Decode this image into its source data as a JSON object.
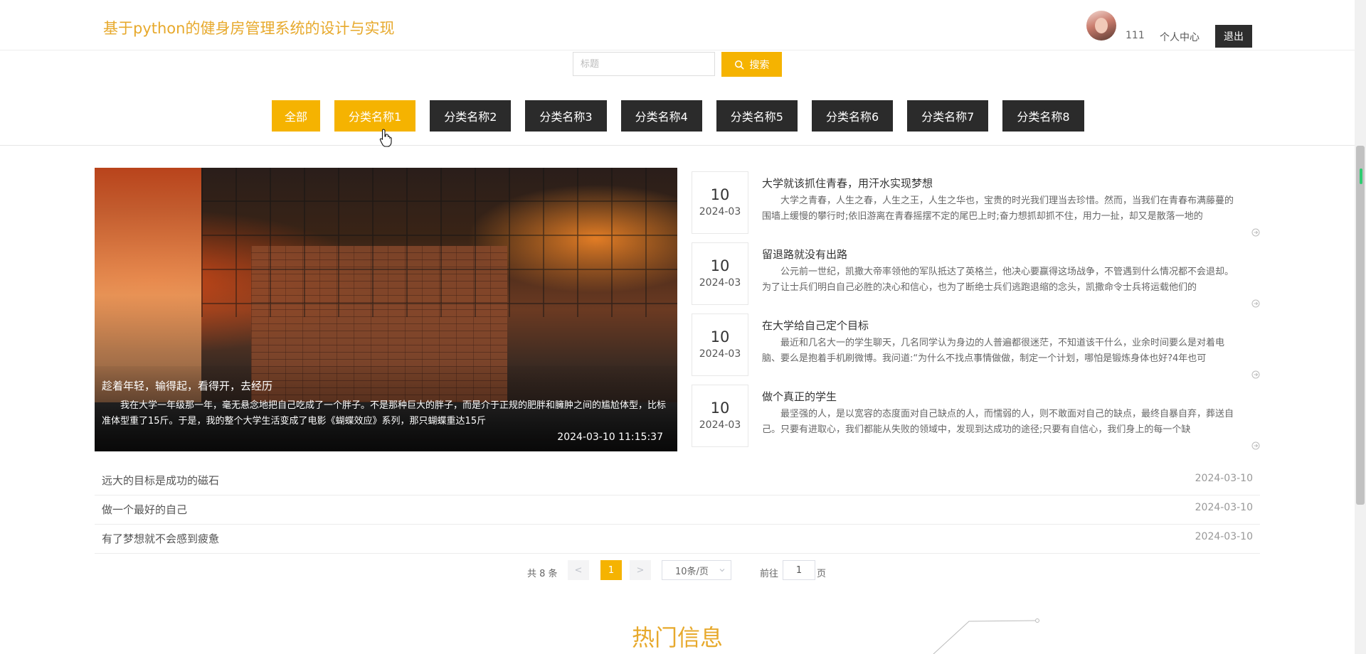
{
  "header": {
    "site_title": "基于python的健身房管理系统的设计与实现",
    "username": "111",
    "personal_center": "个人中心",
    "logout": "退出"
  },
  "search": {
    "placeholder": "标题",
    "button_label": "搜索"
  },
  "categories": [
    {
      "label": "全部"
    },
    {
      "label": "分类名称1"
    },
    {
      "label": "分类名称2"
    },
    {
      "label": "分类名称3"
    },
    {
      "label": "分类名称4"
    },
    {
      "label": "分类名称5"
    },
    {
      "label": "分类名称6"
    },
    {
      "label": "分类名称7"
    },
    {
      "label": "分类名称8"
    }
  ],
  "active_category_index": 1,
  "featured": {
    "title": "趁着年轻，输得起，看得开，去经历",
    "description": "我在大学一年级那一年，毫无悬念地把自己吃成了一个胖子。不是那种巨大的胖子，而是介于正规的肥胖和臃肿之间的尴尬体型，比标准体型重了15斤。于是，我的整个大学生活变成了电影《蝴蝶效应》系列，那只蝴蝶重达15斤",
    "datetime": "2024-03-10 11:15:37"
  },
  "news": [
    {
      "day": "10",
      "year_month": "2024-03",
      "title": "大学就该抓住青春，用汗水实现梦想",
      "desc": "大学之青春，人生之春，人生之王，人生之华也，宝贵的时光我们理当去珍惜。然而，当我们在青春布满藤蔓的围墙上缓慢的攀行时;依旧游离在青春摇摆不定的尾巴上时;奋力想抓却抓不住，用力一扯，却又是散落一地的"
    },
    {
      "day": "10",
      "year_month": "2024-03",
      "title": "留退路就没有出路",
      "desc": "公元前一世纪，凯撒大帝率领他的军队抵达了英格兰，他决心要赢得这场战争，不管遇到什么情况都不会退却。为了让士兵们明白自己必胜的决心和信心，也为了断绝士兵们逃跑退缩的念头，凯撒命令士兵将运载他们的"
    },
    {
      "day": "10",
      "year_month": "2024-03",
      "title": "在大学给自己定个目标",
      "desc": "最近和几名大一的学生聊天，几名同学认为身边的人普遍都很迷茫，不知道该干什么，业余时间要么是对着电脑、要么是抱着手机刷微博。我问道:“为什么不找点事情做做，制定一个计划，哪怕是锻炼身体也好?4年也可"
    },
    {
      "day": "10",
      "year_month": "2024-03",
      "title": "做个真正的学生",
      "desc": "最坚强的人，是以宽容的态度面对自己缺点的人，而懦弱的人，则不敢面对自己的缺点，最终自暴自弃，葬送自己。只要有进取心，我们都能从失败的领域中，发现到达成功的途径;只要有自信心，我们身上的每一个缺"
    }
  ],
  "list_items": [
    {
      "title": "远大的目标是成功的磁石",
      "date": "2024-03-10"
    },
    {
      "title": "做一个最好的自己",
      "date": "2024-03-10"
    },
    {
      "title": "有了梦想就不会感到疲惫",
      "date": "2024-03-10"
    }
  ],
  "pagination": {
    "total_text": "共 8 条",
    "prev": "<",
    "current_page": "1",
    "next": ">",
    "page_size": "10条/页",
    "goto_label": "前往",
    "goto_value": "1",
    "page_label": "页"
  },
  "section": {
    "hot_title": "热门信息"
  },
  "colors": {
    "accent": "#f5b301",
    "title_gold": "#e7a92c",
    "dark_button": "#2b2b2b"
  }
}
